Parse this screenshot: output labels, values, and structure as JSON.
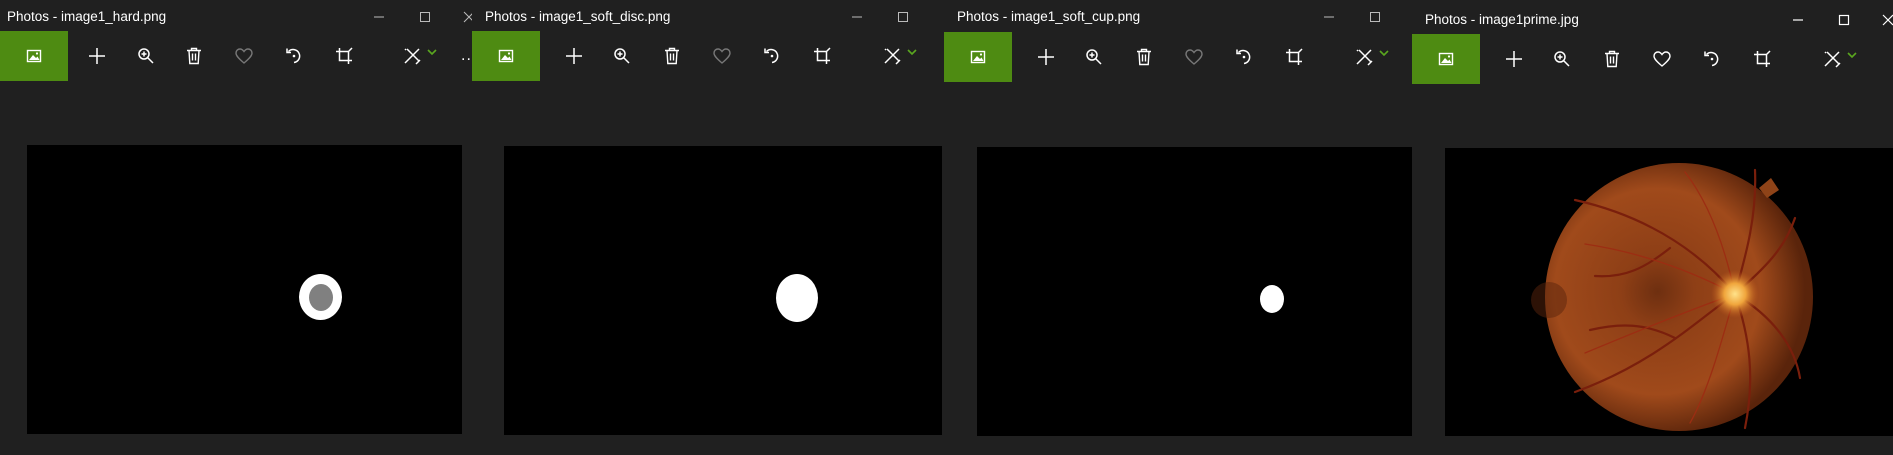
{
  "windows": [
    {
      "id": "win1",
      "title": "Photos - image1_hard.png"
    },
    {
      "id": "win2",
      "title": "Photos - image1_soft_disc.png"
    },
    {
      "id": "win3",
      "title": "Photos - image1_soft_cup.png"
    },
    {
      "id": "win4",
      "title": "Photos - image1prime.jpg"
    }
  ],
  "toolbar": {
    "more_label": "...",
    "icons": [
      "photo-icon",
      "add-icon",
      "zoom-icon",
      "delete-icon",
      "favorite-icon",
      "rotate-icon",
      "crop-icon",
      "edit-icon",
      "chevron-down-icon",
      "more-icon"
    ]
  },
  "colors": {
    "accent": "#4e8b12",
    "window_bg": "#202020",
    "mask_white": "#ffffff",
    "cup_gray": "#808080"
  }
}
